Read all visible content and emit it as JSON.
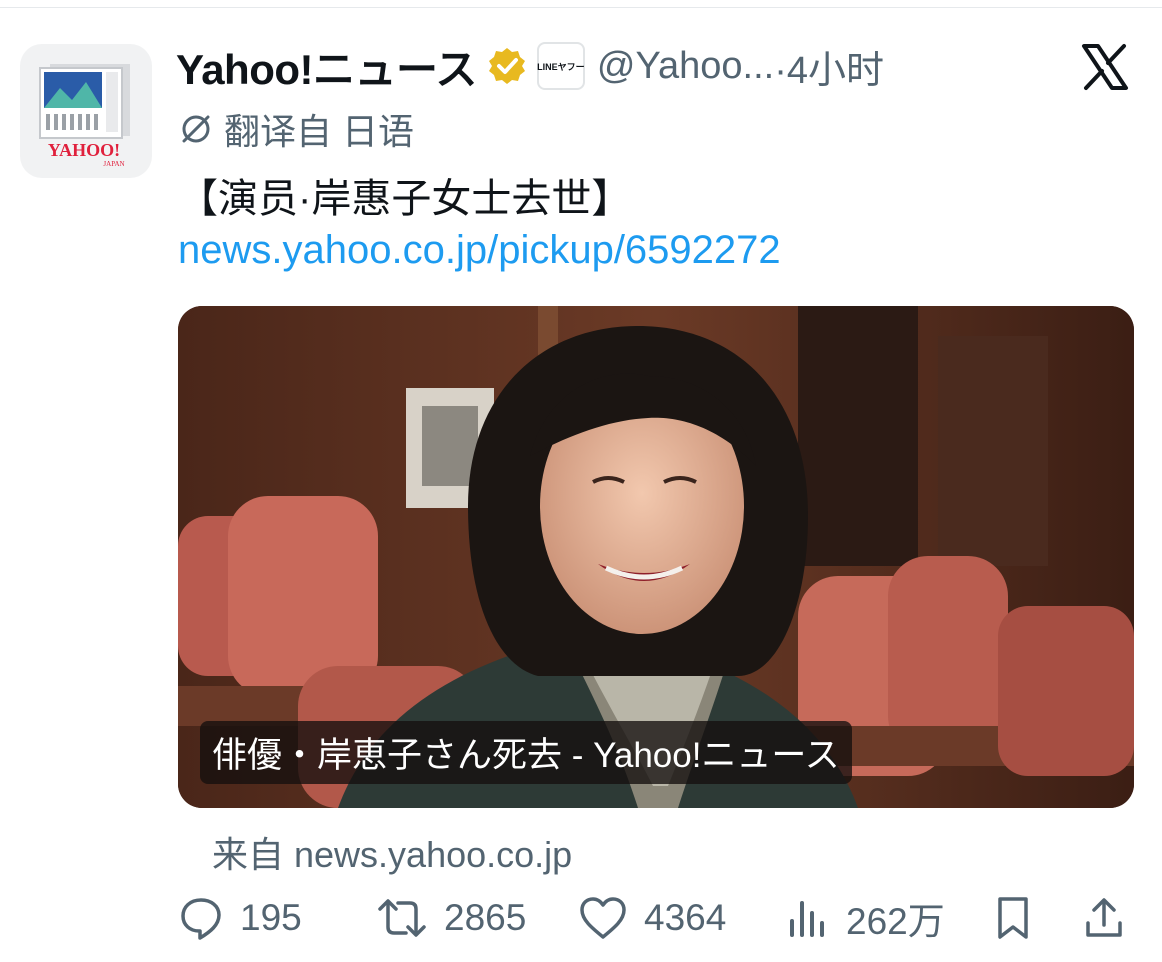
{
  "post": {
    "author_name": "Yahoo!ニュース",
    "verified_icon": "verified-badge-icon",
    "affiliate_badge": "LINEヤフー",
    "handle": "@Yahoo...",
    "time": "·4小时",
    "translation_note": "翻译自 日语",
    "text": "【演员·岸惠子女士去世】",
    "link": "news.yahoo.co.jp/pickup/6592272",
    "avatar_text": "YAHOO!",
    "avatar_subtext": "JAPAN"
  },
  "card": {
    "caption": "俳優・岸恵子さん死去 - Yahoo!ニュース",
    "source": "来自 news.yahoo.co.jp"
  },
  "actions": {
    "replies": "195",
    "reposts": "2865",
    "likes": "4364",
    "views": "262万"
  },
  "colors": {
    "link": "#1d9bf0",
    "secondary": "#536471",
    "verified": "#e8b920"
  }
}
